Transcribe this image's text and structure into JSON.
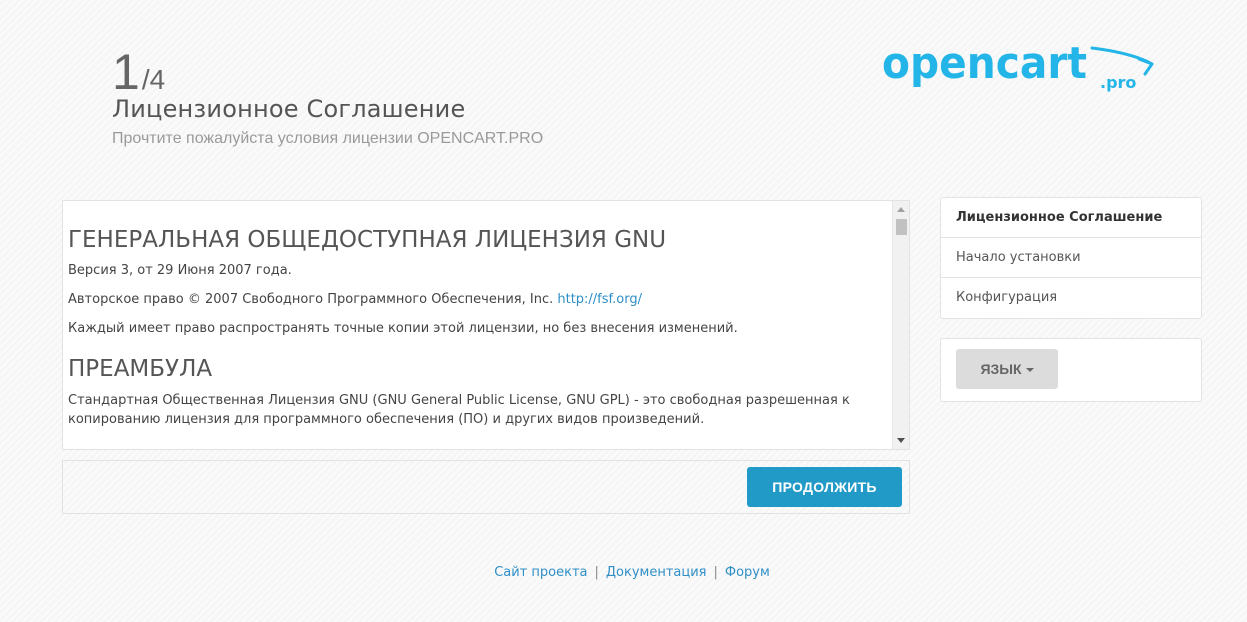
{
  "header": {
    "step_current": "1",
    "step_total": "/4",
    "title": "Лицензионное Соглашение",
    "subtitle": "Прочтите пожалуйста условия лицензии OPENCART.PRO"
  },
  "logo": {
    "main_text": "opencart",
    "suffix_text": ".pro",
    "color": "#23b5e8"
  },
  "license": {
    "heading": "ГЕНЕРАЛЬНАЯ ОБЩЕДОСТУПНАЯ ЛИЦЕНЗИЯ GNU",
    "version": "Версия 3, от 29 Июня 2007 года.",
    "copyright_prefix": "Авторское право © 2007 Свободного Программного Обеспечения, Inc. ",
    "copyright_link": "http://fsf.org/",
    "notice": "Каждый имеет право распространять точные копии этой лицензии, но без внесения изменений.",
    "preamble_heading": "ПРЕАМБУЛА",
    "preamble_text": "Стандартная Общественная Лицензия GNU (GNU General Public License, GNU GPL) - это свободная разрешенная к копированию лицензия для программного обеспечения (ПО) и других видов произведений."
  },
  "actions": {
    "continue_label": "ПРОДОЛЖИТЬ"
  },
  "steps": [
    {
      "label": "Лицензионное Соглашение"
    },
    {
      "label": "Начало установки"
    },
    {
      "label": "Конфигурация"
    }
  ],
  "language": {
    "button_label": "ЯЗЫК"
  },
  "footer": {
    "links": [
      {
        "label": "Сайт проекта"
      },
      {
        "label": "Документация"
      },
      {
        "label": "Форум"
      }
    ],
    "separator": "|"
  },
  "colors": {
    "accent": "#229ac8",
    "link": "#2f8fc7"
  }
}
